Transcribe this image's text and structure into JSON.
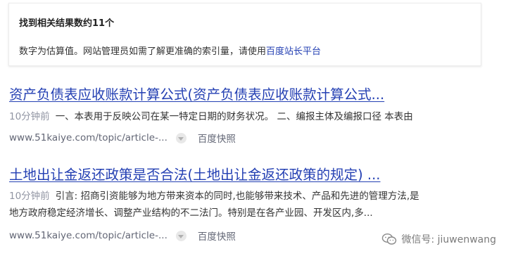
{
  "info_box": {
    "title": "找到相关结果数约11个",
    "text_prefix": "数字为估算值。网站管理员如需了解更准确的索引量，请使用",
    "link": "百度站长平台"
  },
  "results": [
    {
      "title": "资产负债表应收账款计算公式(资产负债表应收账款计算公式...",
      "time": "10分钟前",
      "snippet_lines": [
        "一、本表用于反映公司在某一特定日期的财务状况。 二、编报主体及编报口径 本表由"
      ],
      "url": "www.51kaiye.com/topic/article-...",
      "cache": "百度快照"
    },
    {
      "title": "土地出让金返还政策是否合法(土地出让金返还政策的规定) ...",
      "time": "10分钟前",
      "snippet_lines": [
        "引言: 招商引资能够为地方带来资本的同时,也能够带来技术、产品和先进的管理方法,是",
        "地方政府稳定经济增长、调整产业结构的不二法门。特别是在各产业园、开发区内,多..."
      ],
      "url": "www.51kaiye.com/topic/article-...",
      "cache": "百度快照"
    }
  ],
  "watermark": {
    "text": "微信号: jiuwenwang",
    "icon": "wechat-icon"
  },
  "colors": {
    "link": "#2440b3",
    "time": "#9195a3",
    "url": "#626675"
  }
}
